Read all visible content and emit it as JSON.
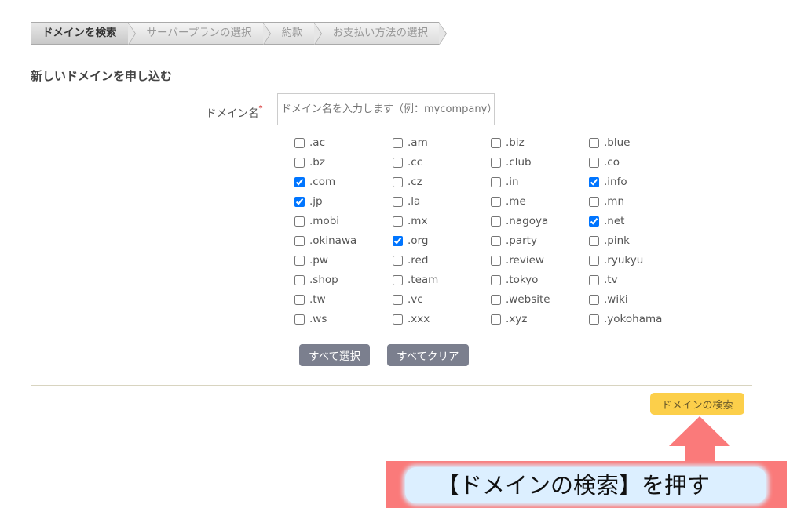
{
  "steps": [
    "ドメインを検索",
    "サーバープランの選択",
    "約款",
    "お支払い方法の選択"
  ],
  "heading": "新しいドメインを申し込む",
  "domain_field": {
    "label": "ドメイン名",
    "required_mark": "*",
    "placeholder": "ドメイン名を入力します（例：mycompany）"
  },
  "tlds": [
    [
      "．ac",
      ".am",
      ".biz",
      ".blue"
    ],
    [
      ".bz",
      ".cc",
      ".club",
      ".co"
    ],
    [
      ".com",
      ".cz",
      ".in",
      ".info"
    ],
    [
      ".jp",
      ".la",
      ".me",
      ".mn"
    ],
    [
      ".mobi",
      ".mx",
      ".nagoya",
      ".net"
    ],
    [
      ".okinawa",
      ".org",
      ".party",
      ".pink"
    ],
    [
      ".pw",
      ".red",
      ".review",
      ".ryukyu"
    ],
    [
      ".shop",
      ".team",
      ".tokyo",
      ".tv"
    ],
    [
      ".tw",
      ".vc",
      ".website",
      ".wiki"
    ],
    [
      ".ws",
      ".xxx",
      ".xyz",
      ".yokohama"
    ]
  ],
  "checked": [
    ".com",
    ".info",
    ".jp",
    ".net",
    ".org"
  ],
  "select_all": "すべて選択",
  "clear_all": "すべてクリア",
  "search_button": "ドメインの検索",
  "annotation": "【ドメインの検索】を押す",
  "colors": {
    "search_button": "#fccf4a",
    "annotation": "#fa7a7a",
    "secondary_button": "#7b7f8e"
  }
}
